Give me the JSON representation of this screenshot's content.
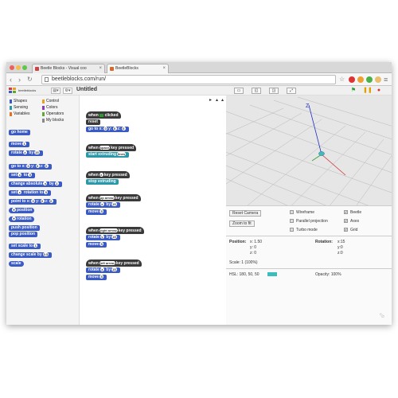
{
  "browser": {
    "tabs": [
      {
        "label": "Beetle Blocks - Visual coo"
      },
      {
        "label": "BeetleBlocks"
      }
    ],
    "url": "beetleblocks.com/run/"
  },
  "app": {
    "project_title": "Untitled",
    "toolbar_icons": [
      "page-icon",
      "gear-icon"
    ]
  },
  "categories": [
    {
      "label": "Shapes",
      "color": "#3a5ac4"
    },
    {
      "label": "Control",
      "color": "#e8a020"
    },
    {
      "label": "Sensing",
      "color": "#2a98a8"
    },
    {
      "label": "Colors",
      "color": "#8a3ab8"
    },
    {
      "label": "Variables",
      "color": "#e87020"
    },
    {
      "label": "Operators",
      "color": "#60a830"
    },
    {
      "label": "My blocks",
      "color": "#888888"
    }
  ],
  "palette_blocks": {
    "go_home": "go home",
    "move": "move",
    "move_val": "1",
    "rotate": "rotate",
    "rotate_axis": "z",
    "rotate_by": "by",
    "rotate_val": "15",
    "goto": "go to x:",
    "goto_x": "0",
    "goto_y_label": "y:",
    "goto_y": "0",
    "goto_z_label": "z:",
    "goto_z": "0",
    "set": "set",
    "set_axis": "x",
    "set_to": "to",
    "set_val": "0",
    "change_absolute": "change absolute",
    "change_abs_axis": "x",
    "change_abs_by": "by",
    "change_abs_val": "1",
    "set_rotation": "set",
    "set_rot_axis": "z",
    "set_rot_label": "rotation to",
    "set_rot_val": "0",
    "point_to": "point to x:",
    "point_x": "0",
    "point_y_label": "y:",
    "point_y": "0",
    "point_z_label": "z:",
    "point_z": "0",
    "position": "position",
    "rotation": "rotation",
    "push_position": "push position",
    "pop_position": "pop position",
    "set_scale": "set scale to",
    "set_scale_val": "1",
    "change_scale": "change scale by",
    "change_scale_val": "0.5",
    "scale": "scale"
  },
  "scripts": {
    "s1_hat": "when",
    "s1_hat_tail": "clicked",
    "s1_reset": "reset",
    "s1_goto": "go to x:",
    "s1_x": "0",
    "s1_y_label": "y:",
    "s1_y": "0",
    "s1_z_label": "z:",
    "s1_z": "0",
    "s2_hat": "when",
    "s2_key": "space",
    "s2_hat_tail": "key pressed",
    "s2_cmd": "start extruding",
    "s2_arg": "lines",
    "s3_hat": "when",
    "s3_key": "x",
    "s3_hat_tail": "key pressed",
    "s3_cmd": "stop extruding",
    "s4_hat": "when",
    "s4_key": "up arrow",
    "s4_hat_tail": "key pressed",
    "s4_cmd": "rotate",
    "s4_axis": "x",
    "s4_by": "by",
    "s4_val": "15",
    "s5_hat": "when",
    "s5_key": "right arrow",
    "s5_hat_tail": "key pressed",
    "s5_cmd": "rotate",
    "s5_axis": "y",
    "s5_by": "by",
    "s5_val": "15",
    "s6_hat": "when",
    "s6_key": "left arrow",
    "s6_hat_tail": "key pressed",
    "s6_cmd": "rotate",
    "s6_axis": "z",
    "s6_by": "by",
    "s6_val": "15",
    "move": "move",
    "move_val": "5"
  },
  "stage": {
    "axis_label": "Z"
  },
  "properties": {
    "reset_camera": "Reset Camera",
    "zoom_to_fit": "Zoom to fit",
    "wireframe": "Wireframe",
    "parallel_projection": "Parallel projection",
    "turbo_mode": "Turbo mode",
    "beetle": "Beetle",
    "axes": "Axes",
    "grid": "Grid",
    "position_label": "Position:",
    "pos_x": "x: 1.50",
    "pos_y": "y: 0",
    "pos_z": "z: 0",
    "rotation_label": "Rotation:",
    "rot_x": "x:15",
    "rot_y": "y:0",
    "rot_z": "z:0",
    "scale": "Scale: 1 (100%)",
    "hsl": "HSL: 180, 50, 50",
    "opacity": "Opacity: 100%",
    "hsl_color": "#3cbcbc"
  }
}
